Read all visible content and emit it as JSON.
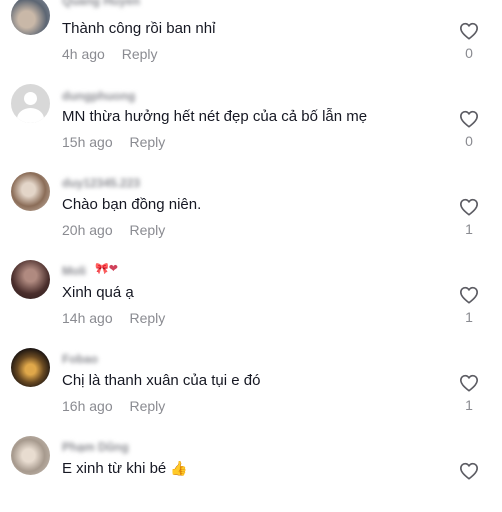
{
  "comments": [
    {
      "username": "Quang Huyen",
      "text": "Thành công rồi ban nhỉ",
      "time": "4h ago",
      "reply_label": "Reply",
      "likes": "0",
      "avatar_color": "#7a8595"
    },
    {
      "username": "dungphuong",
      "text": "MN thừa hưởng hết nét đẹp của cả bố lẫn mẹ",
      "time": "15h ago",
      "reply_label": "Reply",
      "likes": "0",
      "avatar_color": "#d8d8d8"
    },
    {
      "username": "duy12345.223",
      "text": "Chào bạn đồng niên.",
      "time": "20h ago",
      "reply_label": "Reply",
      "likes": "1",
      "avatar_color": "#9a7f6a"
    },
    {
      "username": "Moli",
      "username_decor": "🎀❤",
      "text": "Xinh quá ạ",
      "time": "14h ago",
      "reply_label": "Reply",
      "likes": "1",
      "avatar_color": "#5a3f3a"
    },
    {
      "username": "Fobao",
      "text": "Chị là thanh xuân của tụi e đó",
      "time": "16h ago",
      "reply_label": "Reply",
      "likes": "1",
      "avatar_color": "#3a2a1a"
    },
    {
      "username": "Phạm Dũng",
      "text": "E xinh từ khi bé",
      "text_emoji": "👍",
      "time": "",
      "reply_label": "",
      "likes": "",
      "avatar_color": "#b0a8a0"
    }
  ],
  "icons": {
    "like": "heart-outline-icon"
  }
}
